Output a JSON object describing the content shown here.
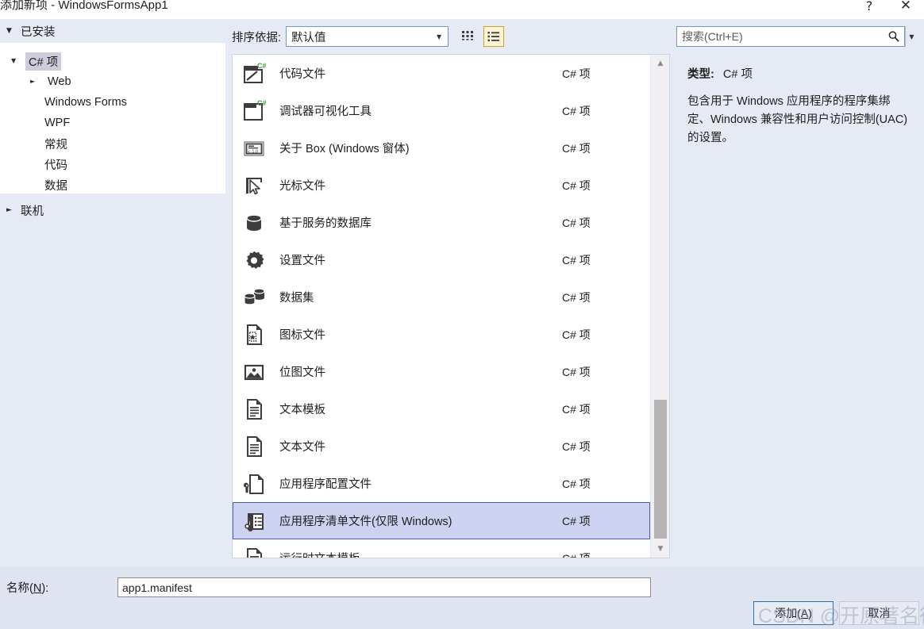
{
  "window": {
    "title": "添加新项 - WindowsFormsApp1",
    "help_icon": "?",
    "close_icon": "✕"
  },
  "sidebar": {
    "installed_header": "已安装",
    "online_header": "联机",
    "items": [
      {
        "label": "C# 项",
        "level": 1,
        "expanded": true,
        "selected": true,
        "has_arrow": true
      },
      {
        "label": "Web",
        "level": 2,
        "expanded": false,
        "selected": false,
        "has_arrow": true
      },
      {
        "label": "Windows Forms",
        "level": 2,
        "expanded": false,
        "selected": false,
        "has_arrow": false
      },
      {
        "label": "WPF",
        "level": 2,
        "expanded": false,
        "selected": false,
        "has_arrow": false
      },
      {
        "label": "常规",
        "level": 2,
        "expanded": false,
        "selected": false,
        "has_arrow": false
      },
      {
        "label": "代码",
        "level": 2,
        "expanded": false,
        "selected": false,
        "has_arrow": false
      },
      {
        "label": "数据",
        "level": 2,
        "expanded": false,
        "selected": false,
        "has_arrow": false
      }
    ]
  },
  "toolbar": {
    "sort_label": "排序依据:",
    "sort_value": "默认值",
    "sort_options": [
      "默认值"
    ],
    "grid_view_name": "large-icons-view",
    "list_view_name": "list-view",
    "list_view_selected": true
  },
  "search": {
    "placeholder": "搜索(Ctrl+E)",
    "value": ""
  },
  "list": {
    "type_column_value": "C# 项",
    "items": [
      {
        "name": "代码文件",
        "type": "C# 项",
        "icon": "csharp-code-file-icon",
        "selected": false
      },
      {
        "name": "调试器可视化工具",
        "type": "C# 项",
        "icon": "csharp-visualizer-icon",
        "selected": false
      },
      {
        "name": "关于 Box (Windows 窗体)",
        "type": "C# 项",
        "icon": "about-box-icon",
        "selected": false
      },
      {
        "name": "光标文件",
        "type": "C# 项",
        "icon": "cursor-file-icon",
        "selected": false
      },
      {
        "name": "基于服务的数据库",
        "type": "C# 项",
        "icon": "database-icon",
        "selected": false
      },
      {
        "name": "设置文件",
        "type": "C# 项",
        "icon": "gear-icon",
        "selected": false
      },
      {
        "name": "数据集",
        "type": "C# 项",
        "icon": "dataset-icon",
        "selected": false
      },
      {
        "name": "图标文件",
        "type": "C# 项",
        "icon": "icon-file-icon",
        "selected": false
      },
      {
        "name": "位图文件",
        "type": "C# 项",
        "icon": "bitmap-file-icon",
        "selected": false
      },
      {
        "name": "文本模板",
        "type": "C# 项",
        "icon": "text-template-icon",
        "selected": false
      },
      {
        "name": "文本文件",
        "type": "C# 项",
        "icon": "text-file-icon",
        "selected": false
      },
      {
        "name": "应用程序配置文件",
        "type": "C# 项",
        "icon": "app-config-file-icon",
        "selected": false
      },
      {
        "name": "应用程序清单文件(仅限 Windows)",
        "type": "C# 项",
        "icon": "app-manifest-file-icon",
        "selected": true
      },
      {
        "name": "运行时文本模板",
        "type": "C# 项",
        "icon": "runtime-text-template-icon",
        "selected": false
      }
    ]
  },
  "details": {
    "type_label": "类型:",
    "type_value": "C# 项",
    "description": "包含用于 Windows 应用程序的程序集绑定、Windows 兼容性和用户访问控制(UAC)的设置。"
  },
  "footer": {
    "name_label_prefix": "名称(",
    "name_label_key": "N",
    "name_label_suffix": "):",
    "name_value": "app1.manifest",
    "add_button_prefix": "添加(",
    "add_button_key": "A",
    "add_button_suffix": ")",
    "cancel_button": "取消"
  },
  "watermark": {
    "text": "CSDN @开原著名很人"
  },
  "colors": {
    "dialog_bg": "#e6eaf4",
    "panel_white": "#ffffff",
    "selected_row_bg": "#ccd2ef",
    "selected_row_border": "#4b5fa8",
    "tree_selected_bg": "#ccccdd",
    "view_toggle_active_bg": "#fdf4d2",
    "view_toggle_active_border": "#c9a227",
    "primary_button_border": "#2a6fb5",
    "csharp_green": "#3f9a3f"
  }
}
